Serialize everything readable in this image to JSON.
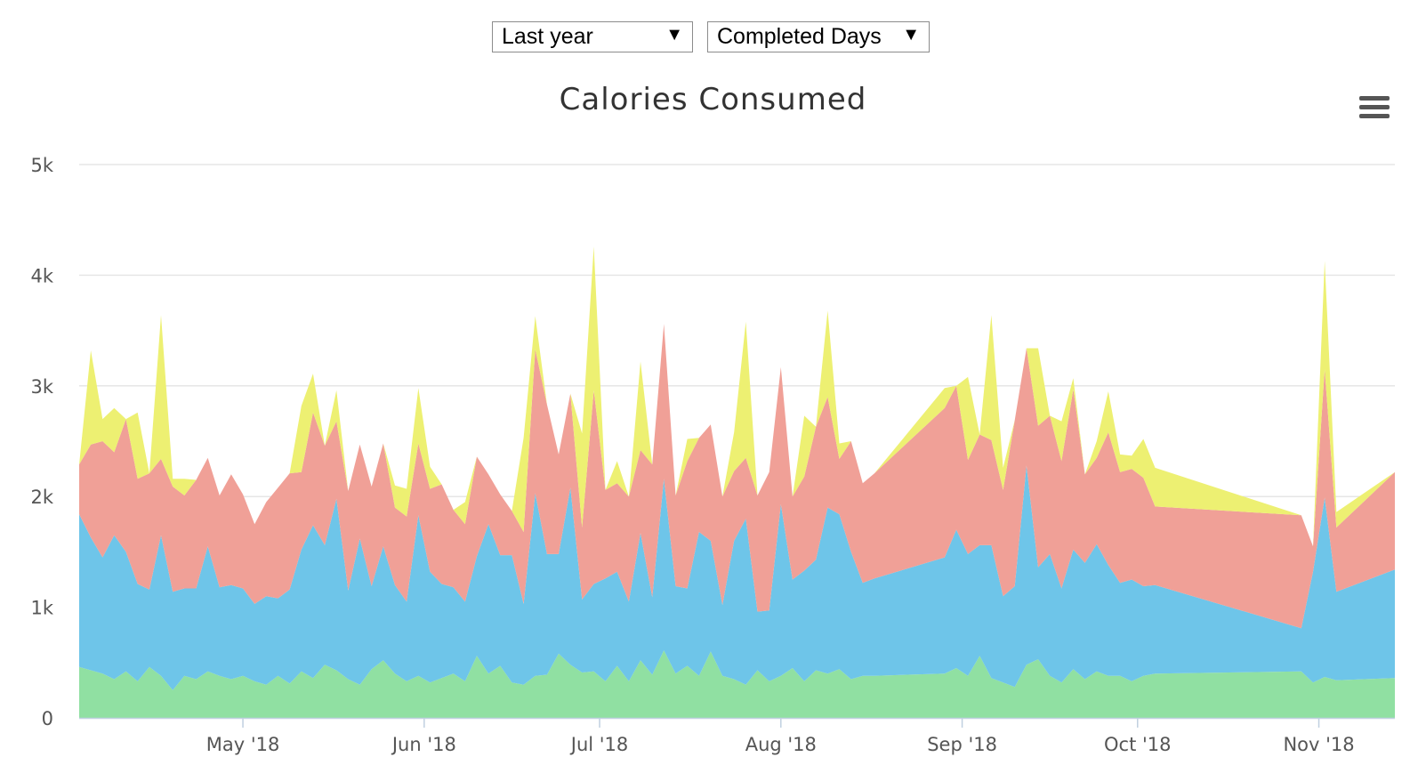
{
  "controls": {
    "range_label": "Last year",
    "type_label": "Completed Days",
    "arrow": "▼"
  },
  "menu_icon": "hamburger-menu-icon",
  "chart_data": {
    "type": "area",
    "stacked": true,
    "title": "Calories Consumed",
    "xlabel": "",
    "ylabel": "",
    "ylim": [
      0,
      5000
    ],
    "yticks": [
      0,
      1000,
      2000,
      3000,
      4000,
      5000
    ],
    "ytick_labels": [
      "0",
      "1k",
      "2k",
      "3k",
      "4k",
      "5k"
    ],
    "x_range": [
      "2018-04-03",
      "2018-11-14"
    ],
    "xticks": [
      {
        "date": "2018-05-01",
        "label": "May '18"
      },
      {
        "date": "2018-06-01",
        "label": "Jun '18"
      },
      {
        "date": "2018-07-01",
        "label": "Jul '18"
      },
      {
        "date": "2018-08-01",
        "label": "Aug '18"
      },
      {
        "date": "2018-09-01",
        "label": "Sep '18"
      },
      {
        "date": "2018-10-01",
        "label": "Oct '18"
      },
      {
        "date": "2018-11-01",
        "label": "Nov '18"
      }
    ],
    "grid": true,
    "legend": false,
    "dates": [
      "2018-04-03",
      "2018-04-05",
      "2018-04-07",
      "2018-04-09",
      "2018-04-11",
      "2018-04-13",
      "2018-04-15",
      "2018-04-17",
      "2018-04-19",
      "2018-04-21",
      "2018-04-23",
      "2018-04-25",
      "2018-04-27",
      "2018-04-29",
      "2018-05-01",
      "2018-05-03",
      "2018-05-05",
      "2018-05-07",
      "2018-05-09",
      "2018-05-11",
      "2018-05-13",
      "2018-05-15",
      "2018-05-17",
      "2018-05-19",
      "2018-05-21",
      "2018-05-23",
      "2018-05-25",
      "2018-05-27",
      "2018-05-29",
      "2018-05-31",
      "2018-06-02",
      "2018-06-04",
      "2018-06-06",
      "2018-06-08",
      "2018-06-10",
      "2018-06-12",
      "2018-06-14",
      "2018-06-16",
      "2018-06-18",
      "2018-06-20",
      "2018-06-22",
      "2018-06-24",
      "2018-06-26",
      "2018-06-28",
      "2018-06-30",
      "2018-07-02",
      "2018-07-04",
      "2018-07-06",
      "2018-07-08",
      "2018-07-10",
      "2018-07-12",
      "2018-07-14",
      "2018-07-16",
      "2018-07-18",
      "2018-07-20",
      "2018-07-22",
      "2018-07-24",
      "2018-07-26",
      "2018-07-28",
      "2018-07-30",
      "2018-08-01",
      "2018-08-03",
      "2018-08-05",
      "2018-08-07",
      "2018-08-09",
      "2018-08-11",
      "2018-08-13",
      "2018-08-15",
      "2018-08-17",
      "2018-08-29",
      "2018-08-31",
      "2018-09-02",
      "2018-09-04",
      "2018-09-06",
      "2018-09-08",
      "2018-09-10",
      "2018-09-12",
      "2018-09-14",
      "2018-09-16",
      "2018-09-18",
      "2018-09-20",
      "2018-09-22",
      "2018-09-24",
      "2018-09-26",
      "2018-09-28",
      "2018-09-30",
      "2018-10-02",
      "2018-10-04",
      "2018-10-29",
      "2018-10-31",
      "2018-11-02",
      "2018-11-04",
      "2018-11-14"
    ],
    "series": [
      {
        "color": "#90e0a2",
        "values": [
          460,
          430,
          400,
          350,
          420,
          330,
          460,
          380,
          250,
          380,
          350,
          420,
          380,
          350,
          380,
          330,
          300,
          380,
          310,
          420,
          360,
          480,
          430,
          350,
          300,
          440,
          520,
          400,
          330,
          380,
          320,
          360,
          400,
          330,
          560,
          400,
          470,
          320,
          300,
          380,
          390,
          580,
          480,
          410,
          420,
          330,
          470,
          330,
          520,
          390,
          610,
          400,
          470,
          380,
          600,
          380,
          350,
          300,
          430,
          330,
          380,
          450,
          330,
          430,
          400,
          440,
          350,
          380,
          380,
          400,
          450,
          380,
          560,
          360,
          320,
          280,
          480,
          530,
          380,
          320,
          440,
          350,
          420,
          380,
          380,
          330,
          380,
          400,
          420,
          320,
          370,
          340,
          360
        ]
      },
      {
        "color": "#6ec5e9",
        "values": [
          1380,
          1200,
          1050,
          1300,
          1080,
          880,
          700,
          1270,
          890,
          790,
          820,
          1130,
          800,
          850,
          790,
          700,
          800,
          700,
          850,
          1100,
          1380,
          1080,
          1550,
          800,
          1320,
          750,
          1030,
          800,
          720,
          1450,
          1000,
          850,
          780,
          720,
          900,
          1350,
          1000,
          1150,
          730,
          1650,
          1090,
          900,
          1600,
          660,
          790,
          930,
          850,
          720,
          1150,
          700,
          1550,
          790,
          700,
          1300,
          1000,
          640,
          1250,
          1500,
          530,
          640,
          1550,
          800,
          1000,
          1000,
          1500,
          1400,
          1150,
          840,
          880,
          1050,
          1250,
          1100,
          1000,
          1200,
          780,
          910,
          1800,
          830,
          1100,
          850,
          1080,
          1050,
          1150,
          1000,
          840,
          920,
          810,
          800,
          390,
          1000,
          1620,
          800,
          980
        ]
      },
      {
        "color": "#f0a097",
        "values": [
          450,
          840,
          1050,
          750,
          1200,
          950,
          1050,
          690,
          950,
          840,
          980,
          800,
          830,
          1000,
          850,
          720,
          850,
          1000,
          1050,
          700,
          1020,
          900,
          700,
          900,
          850,
          900,
          930,
          700,
          770,
          650,
          750,
          900,
          700,
          700,
          900,
          450,
          550,
          400,
          650,
          1300,
          1350,
          900,
          850,
          650,
          1750,
          800,
          800,
          950,
          750,
          1200,
          1400,
          820,
          1150,
          850,
          1050,
          980,
          630,
          550,
          1050,
          1250,
          1240,
          750,
          850,
          1200,
          1000,
          500,
          1000,
          900,
          950,
          1350,
          1300,
          850,
          1000,
          950,
          960,
          1500,
          1060,
          1280,
          1250,
          1150,
          1450,
          800,
          780,
          1200,
          1000,
          1000,
          980,
          710,
          1020,
          230,
          1160,
          580,
          880
        ]
      },
      {
        "color": "#edf072",
        "values": [
          0,
          850,
          200,
          400,
          0,
          600,
          0,
          1300,
          70,
          150,
          0,
          0,
          0,
          0,
          0,
          0,
          0,
          0,
          0,
          600,
          350,
          0,
          280,
          0,
          0,
          0,
          0,
          200,
          250,
          500,
          200,
          0,
          0,
          200,
          0,
          0,
          0,
          0,
          850,
          300,
          0,
          0,
          0,
          850,
          1300,
          0,
          200,
          0,
          800,
          0,
          0,
          0,
          200,
          0,
          0,
          0,
          350,
          1230,
          0,
          0,
          0,
          0,
          550,
          0,
          780,
          140,
          0,
          0,
          0,
          180,
          0,
          750,
          0,
          1130,
          200,
          0,
          0,
          700,
          0,
          360,
          100,
          0,
          150,
          370,
          160,
          120,
          350,
          350,
          0,
          0,
          980,
          140,
          0
        ]
      }
    ]
  }
}
